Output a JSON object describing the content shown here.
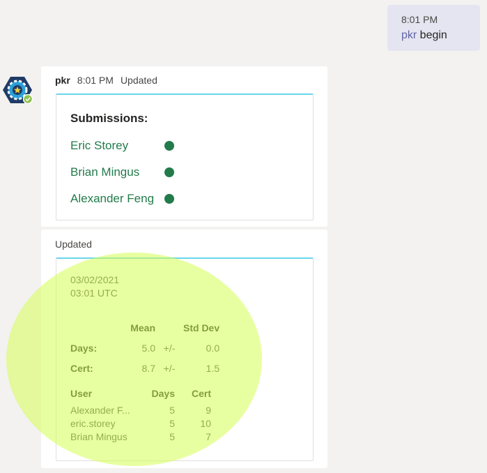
{
  "outgoing": {
    "time": "8:01 PM",
    "command": "pkr",
    "text": " begin"
  },
  "bot": {
    "avatar_icon": "poker-chip-icon",
    "status_icon": "online-check-icon",
    "status_color": "#92c353",
    "name": "pkr",
    "time": "8:01 PM",
    "status": "Updated"
  },
  "submissions": {
    "title": "Submissions:",
    "items": [
      {
        "name": "Eric Storey",
        "status_color": "#237b4b"
      },
      {
        "name": "Brian Mingus",
        "status_color": "#237b4b"
      },
      {
        "name": "Alexander Feng",
        "status_color": "#237b4b"
      }
    ]
  },
  "update": {
    "label": "Updated",
    "date": "03/02/2021",
    "time": "03:01 UTC",
    "stats": {
      "headers": {
        "mean": "Mean",
        "std": "Std Dev"
      },
      "rows": [
        {
          "label": "Days:",
          "mean": "5.0",
          "pm": "+/-",
          "std": "0.0"
        },
        {
          "label": "Cert:",
          "mean": "8.7",
          "pm": "+/-",
          "std": "1.5"
        }
      ]
    },
    "users": {
      "headers": {
        "user": "User",
        "days": "Days",
        "cert": "Cert"
      },
      "rows": [
        {
          "user": "Alexander F...",
          "days": "5",
          "cert": "9"
        },
        {
          "user": "eric.storey",
          "days": "5",
          "cert": "10"
        },
        {
          "user": "Brian Mingus",
          "days": "5",
          "cert": "7"
        }
      ]
    }
  },
  "colors": {
    "accent": "#6264a7",
    "card_top_border": "#6ad6ec",
    "submission_green": "#237b4b",
    "highlight": "#d6ff54"
  }
}
